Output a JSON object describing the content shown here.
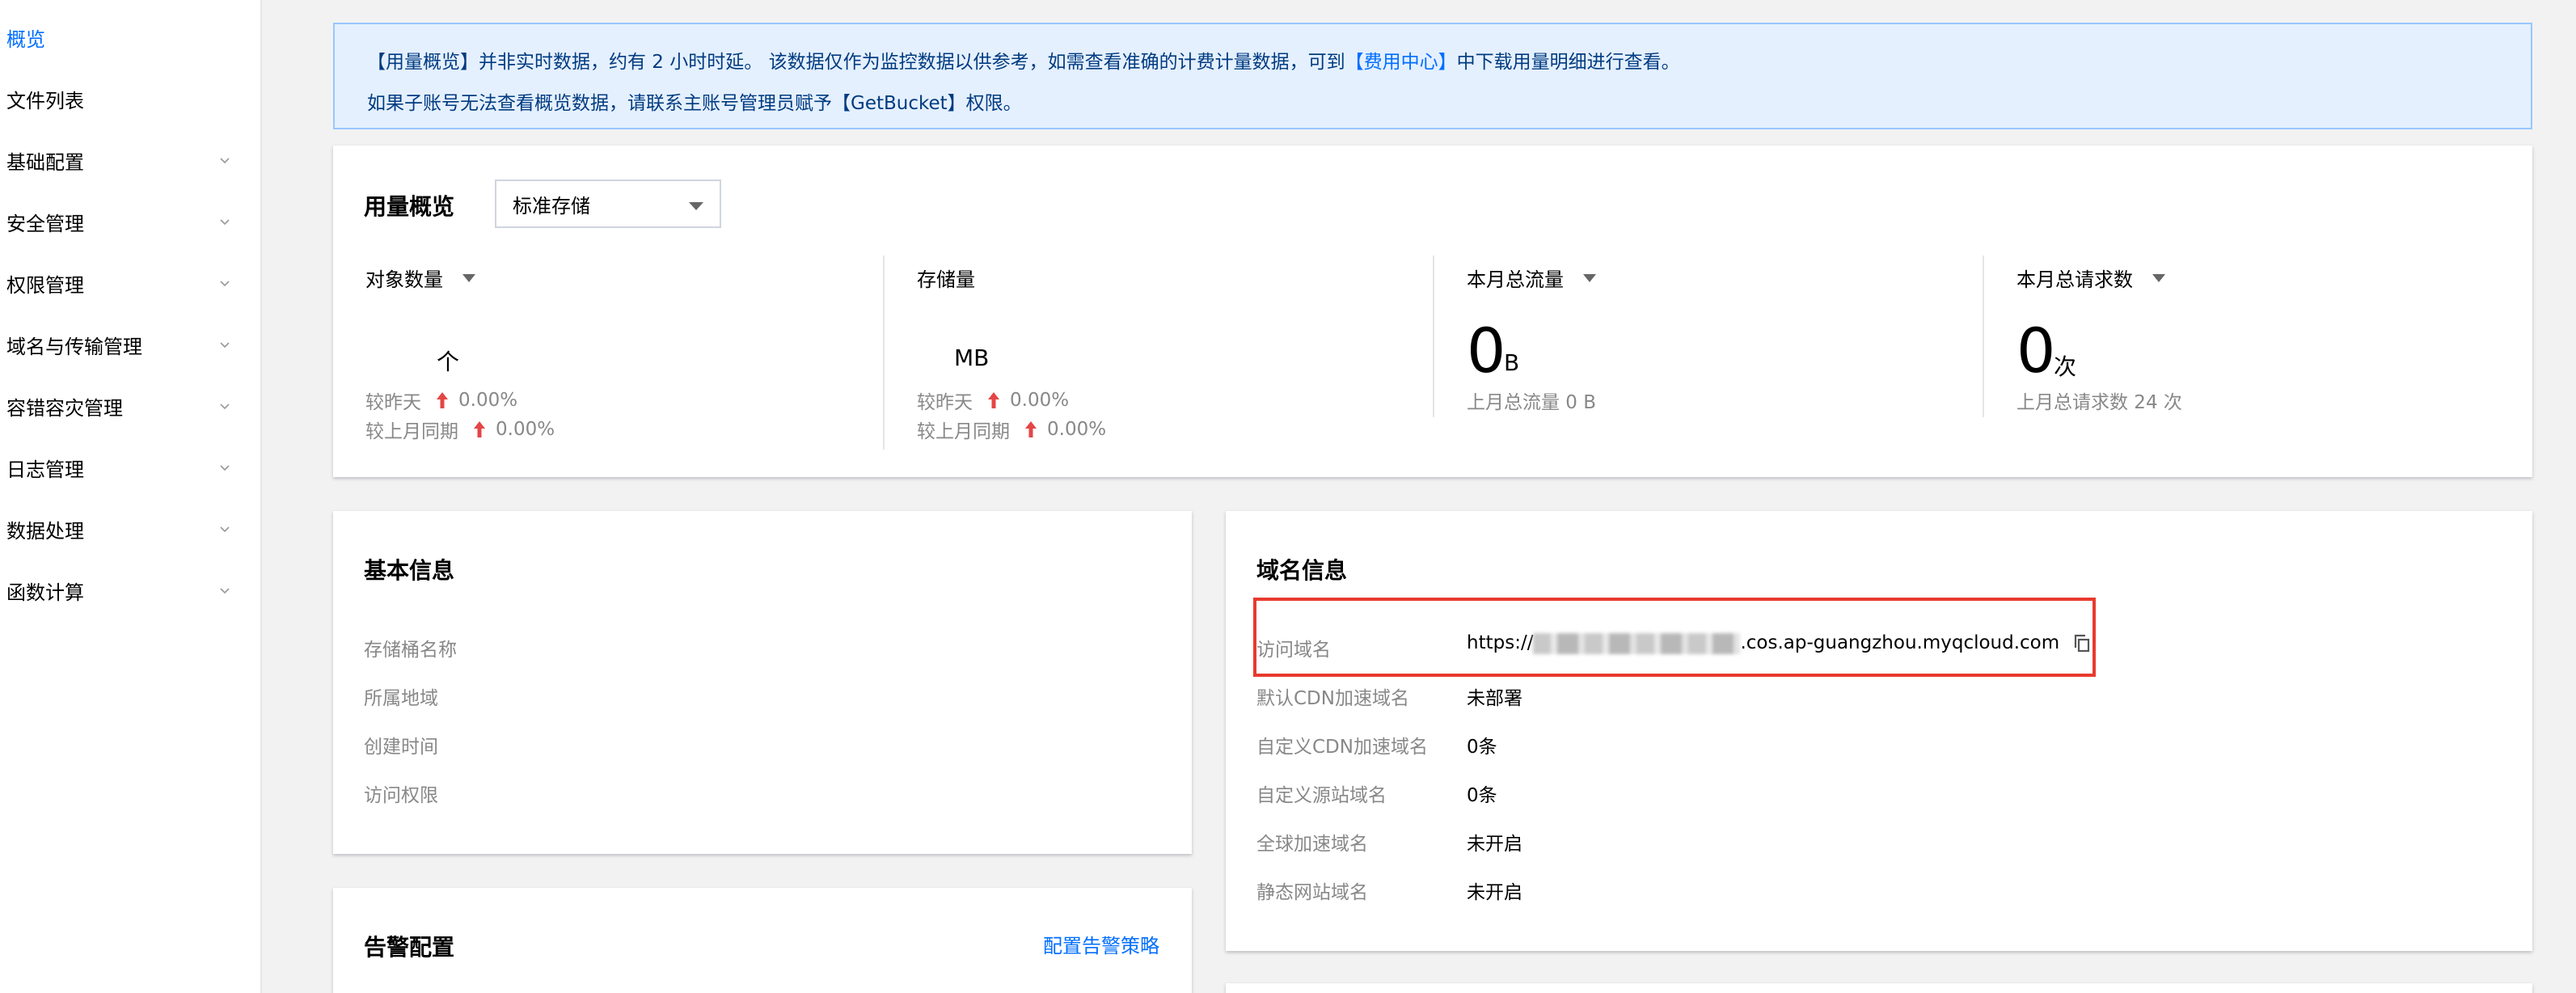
{
  "sidebar": {
    "items": [
      {
        "label": "概览",
        "active": true,
        "expandable": false
      },
      {
        "label": "文件列表",
        "active": false,
        "expandable": false
      },
      {
        "label": "基础配置",
        "active": false,
        "expandable": true
      },
      {
        "label": "安全管理",
        "active": false,
        "expandable": true
      },
      {
        "label": "权限管理",
        "active": false,
        "expandable": true
      },
      {
        "label": "域名与传输管理",
        "active": false,
        "expandable": true
      },
      {
        "label": "容错容灾管理",
        "active": false,
        "expandable": true
      },
      {
        "label": "日志管理",
        "active": false,
        "expandable": true
      },
      {
        "label": "数据处理",
        "active": false,
        "expandable": true
      },
      {
        "label": "函数计算",
        "active": false,
        "expandable": true
      }
    ]
  },
  "notice": {
    "line1_prefix": "【用量概览】并非实时数据，约有 2 小时时延。 该数据仅作为监控数据以供参考，如需查看准确的计费计量数据，可到",
    "line1_link": "【费用中心】",
    "line1_suffix": "中下载用量明细进行查看。",
    "line2": "如果子账号无法查看概览数据，请联系主账号管理员赋予【GetBucket】权限。"
  },
  "usage": {
    "title": "用量概览",
    "storage_select": "标准存储",
    "objects": {
      "label": "对象数量",
      "unit": "个",
      "vs_yesterday_label": "较昨天",
      "vs_yesterday": "0.00%",
      "vs_last_month_label": "较上月同期",
      "vs_last_month": "0.00%"
    },
    "storage": {
      "label": "存储量",
      "unit": "MB",
      "vs_yesterday_label": "较昨天",
      "vs_yesterday": "0.00%",
      "vs_last_month_label": "较上月同期",
      "vs_last_month": "0.00%"
    },
    "traffic": {
      "label": "本月总流量",
      "value": "0",
      "unit": "B",
      "last_month": "上月总流量 0 B"
    },
    "requests": {
      "label": "本月总请求数",
      "value": "0",
      "unit": "次",
      "last_month": "上月总请求数 24 次"
    }
  },
  "basic_info": {
    "title": "基本信息",
    "fields": [
      "存储桶名称",
      "所属地域",
      "创建时间",
      "访问权限"
    ]
  },
  "alert": {
    "title": "告警配置",
    "action": "配置告警策略"
  },
  "domain_info": {
    "title": "域名信息",
    "rows": [
      {
        "label": "访问域名",
        "prefix": "https://",
        "value": ".cos.ap-guangzhou.myqcloud.com"
      },
      {
        "label": "默认CDN加速域名",
        "value": "未部署"
      },
      {
        "label": "自定义CDN加速域名",
        "value": "0条"
      },
      {
        "label": "自定义源站域名",
        "value": "0条"
      },
      {
        "label": "全球加速域名",
        "value": "未开启"
      },
      {
        "label": "静态网站域名",
        "value": "未开启"
      }
    ]
  },
  "colors": {
    "accent": "#006eff",
    "highlight_border": "#e83a2e",
    "up_arrow": "#e54545",
    "notice_bg": "#e5f0ff"
  }
}
